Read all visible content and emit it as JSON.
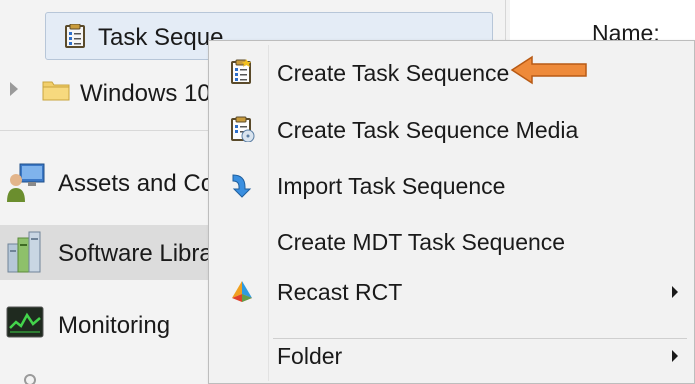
{
  "tree": {
    "selected_item_label": "Task Seque",
    "folder_item_label": "Windows 10"
  },
  "wunderbar": {
    "items": [
      {
        "label": "Assets and Co",
        "icon": "assets-icon"
      },
      {
        "label": "Software Libra",
        "icon": "software-library-icon"
      },
      {
        "label": "Monitoring",
        "icon": "monitoring-icon"
      }
    ]
  },
  "details": {
    "name_label": "Name:"
  },
  "context_menu": {
    "items": [
      {
        "label": "Create Task Sequence",
        "icon": "task-sequence-icon",
        "submenu": false
      },
      {
        "label": "Create Task Sequence Media",
        "icon": "task-sequence-media-icon",
        "submenu": false
      },
      {
        "label": "Import Task Sequence",
        "icon": "import-arrow-icon",
        "submenu": false
      },
      {
        "label": "Create MDT Task Sequence",
        "icon": "",
        "submenu": false
      },
      {
        "label": "Recast RCT",
        "icon": "recast-rct-icon",
        "submenu": true
      },
      {
        "label": "Folder",
        "icon": "",
        "submenu": true
      }
    ]
  },
  "annotation": {
    "arrow_color": "#e87722",
    "arrow_target": "Create Task Sequence"
  },
  "colors": {
    "menu_background": "#f2f2f2",
    "nav_background": "#f3f3f3",
    "selection_background": "#e4ecf6",
    "accent_arrow": "#e87722"
  }
}
